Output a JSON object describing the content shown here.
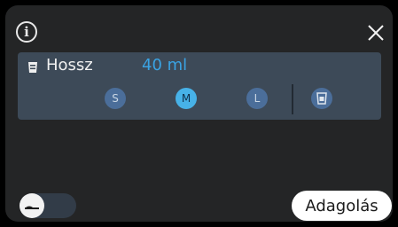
{
  "header": {
    "info_icon": "info-icon",
    "info_glyph": "i",
    "close_icon": "close-icon"
  },
  "panel": {
    "icon": "cup-icon",
    "title": "Hossz",
    "value": "40 ml",
    "sizes": [
      {
        "label": "S",
        "selected": false
      },
      {
        "label": "M",
        "selected": true
      },
      {
        "label": "L",
        "selected": false
      }
    ],
    "custom_icon": "custom-cup-icon"
  },
  "footer": {
    "toggle_icon": "milk-frother-icon",
    "dispense_label": "Adagolás"
  },
  "colors": {
    "background": "#242526",
    "panel": "#3d4a58",
    "accent": "#3aa3e3",
    "size_button": "#4b6e9a",
    "size_button_selected": "#47b2e8"
  }
}
